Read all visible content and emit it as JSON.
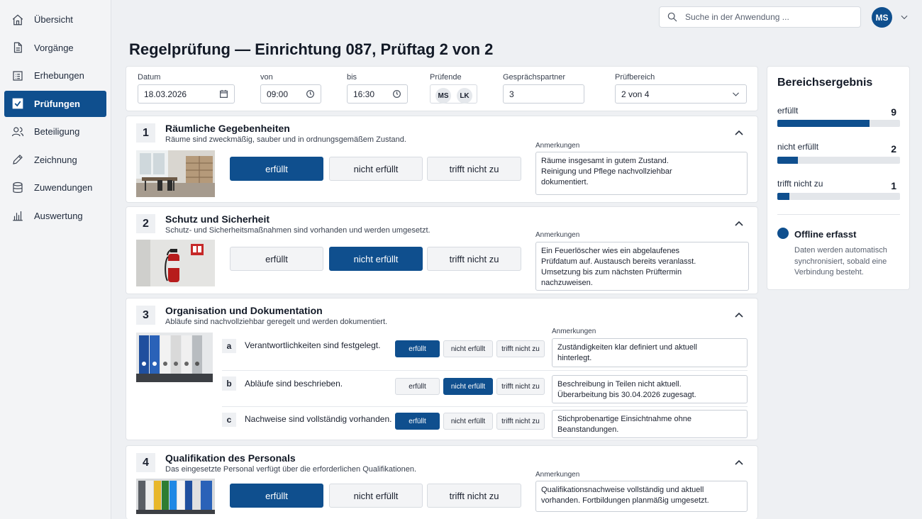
{
  "nav": [
    {
      "label": "Übersicht",
      "icon": "home-icon"
    },
    {
      "label": "Vorgänge",
      "icon": "document-icon"
    },
    {
      "label": "Erhebungen",
      "icon": "list-icon"
    },
    {
      "label": "Prüfungen",
      "icon": "checkbox-icon",
      "active": true
    },
    {
      "label": "Beteiligung",
      "icon": "users-icon"
    },
    {
      "label": "Zeichnung",
      "icon": "pen-icon"
    },
    {
      "label": "Zuwendungen",
      "icon": "database-icon"
    },
    {
      "label": "Auswertung",
      "icon": "bar-chart-icon"
    }
  ],
  "search": {
    "placeholder": "Suche in der Anwendung ..."
  },
  "user": {
    "initials": "MS"
  },
  "page": {
    "title": "Regelprüfung — Einrichtung 087, Prüftag 2 von 2"
  },
  "header": {
    "datum_label": "Datum",
    "datum_value": "18.03.2026",
    "von_label": "von",
    "von_value": "09:00",
    "bis_label": "bis",
    "bis_value": "16:30",
    "pruefende_label": "Prüfende",
    "pruefende": [
      "MS",
      "LK"
    ],
    "gespraech_label": "Gesprächspartner",
    "gespraech_value": "3",
    "bereich_label": "Prüfbereich",
    "bereich_value": "2 von 4"
  },
  "options": {
    "yes": "erfüllt",
    "no": "nicht erfüllt",
    "na": "trifft nicht zu"
  },
  "notes_label": "Anmerkungen",
  "sections": [
    {
      "num": "1",
      "title": "Räumliche Gegebenheiten",
      "desc": "Räume sind zweckmäßig, sauber und in ordnungsgemäßem Zustand.",
      "selected": "yes",
      "note": "Räume insgesamt in gutem Zustand.\nReinigung und Pflege nachvollziehbar\ndokumentiert."
    },
    {
      "num": "2",
      "title": "Schutz und Sicherheit",
      "desc": "Schutz- und Sicherheitsmaßnahmen sind vorhanden und werden umgesetzt.",
      "selected": "no",
      "note": "Ein Feuerlöscher wies ein abgelaufenes\nPrüfdatum auf. Austausch bereits veranlasst.\nUmsetzung bis zum nächsten Prüftermin\nnachzuweisen."
    },
    {
      "num": "3",
      "title": "Organisation und Dokumentation",
      "desc": "Abläufe sind nachvollziehbar geregelt und werden dokumentiert.",
      "items": [
        {
          "letter": "a",
          "text": "Verantwortlichkeiten sind festgelegt.",
          "selected": "yes",
          "note": "Zuständigkeiten klar definiert und aktuell\nhinterlegt."
        },
        {
          "letter": "b",
          "text": "Abläufe sind beschrieben.",
          "selected": "no",
          "note": "Beschreibung in Teilen nicht aktuell.\nÜberarbeitung bis 30.04.2026 zugesagt."
        },
        {
          "letter": "c",
          "text": "Nachweise sind vollständig vorhanden.",
          "selected": "yes",
          "note": "Stichprobenartige Einsichtnahme ohne\nBeanstandungen."
        }
      ]
    },
    {
      "num": "4",
      "title": "Qualifikation des Personals",
      "desc": "Das eingesetzte Personal verfügt über die erforderlichen Qualifikationen.",
      "selected": "yes",
      "note": "Qualifikationsnachweise vollständig und aktuell\nvorhanden. Fortbildungen planmäßig umgesetzt."
    }
  ],
  "summary": {
    "title": "Bereichsergebnis",
    "stats": [
      {
        "label": "erfüllt",
        "value": "9",
        "fraction": 0.75
      },
      {
        "label": "nicht erfüllt",
        "value": "2",
        "fraction": 0.167
      },
      {
        "label": "trifft nicht zu",
        "value": "1",
        "fraction": 0.1
      }
    ],
    "offline_title": "Offline erfasst",
    "offline_text": "Daten werden automatisch synchronisiert, sobald eine Verbindung besteht."
  },
  "colors": {
    "accent": "#0f4f8e"
  }
}
